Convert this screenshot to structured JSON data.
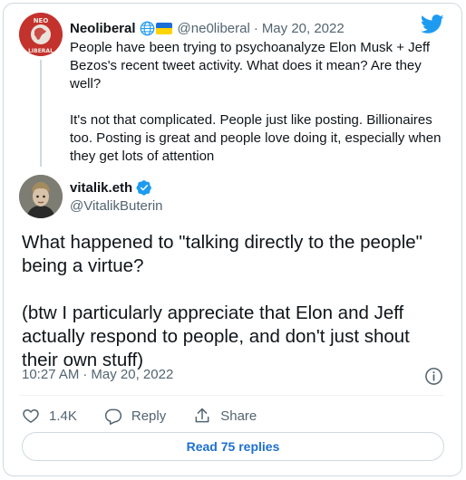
{
  "brand": {
    "logo": "twitter-bird-icon",
    "color": "#1d9bf0"
  },
  "quoted_tweet": {
    "author_name": "Neoliberal",
    "badges": [
      "globe-icon",
      "ukraine-flag-icon"
    ],
    "handle": "@ne0liberal",
    "separator": "·",
    "date": "May 20, 2022",
    "avatar_text": "NEO LIBERAL",
    "paragraphs": [
      "People have been trying to psychoanalyze Elon Musk + Jeff Bezos's recent tweet activity. What does it mean? Are they well?",
      "It's not that complicated. People just like posting. Billionaires too. Posting is great and people love doing it, especially when they get lots of attention"
    ]
  },
  "main_tweet": {
    "author_name": "vitalik.eth",
    "verified": true,
    "handle": "@VitalikButerin",
    "paragraphs": [
      "What happened to \"talking directly to the people\" being a virtue?",
      "(btw I particularly appreciate that Elon and Jeff actually respond to people, and don't just shout their own stuff)"
    ],
    "time": "10:27 AM",
    "separator": "·",
    "date": "May 20, 2022"
  },
  "actions": {
    "like_count": "1.4K",
    "reply_label": "Reply",
    "share_label": "Share"
  },
  "read_replies_label": "Read 75 replies",
  "colors": {
    "text": "#0f1419",
    "secondary": "#536471",
    "link": "#1d6fd0",
    "border": "#cfd9de",
    "neo_red": "#c4322d"
  }
}
